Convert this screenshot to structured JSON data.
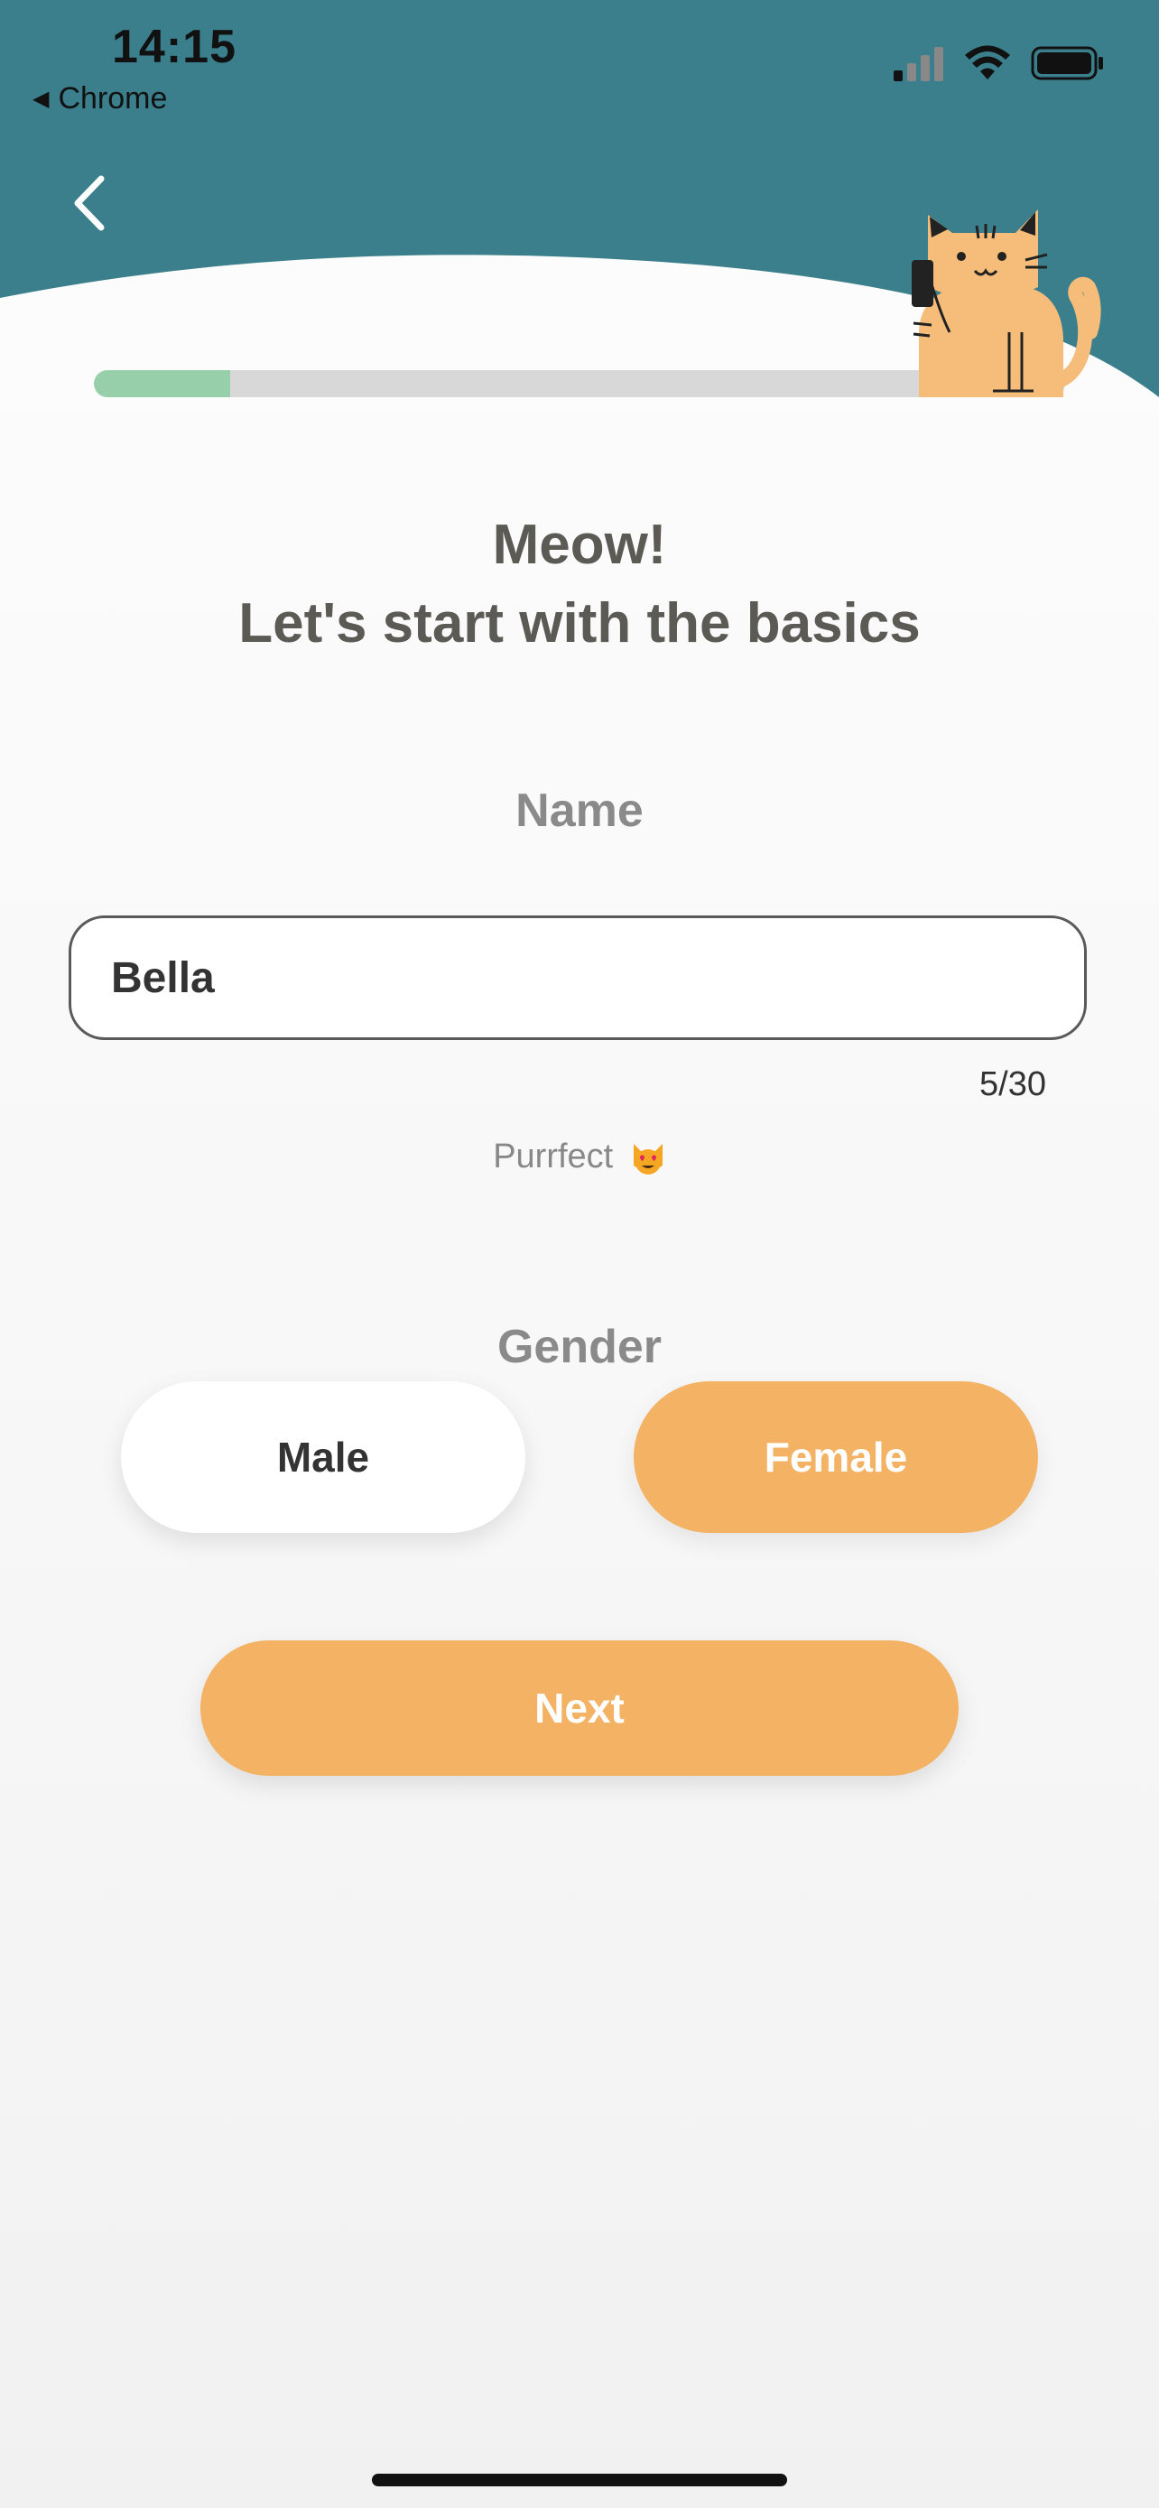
{
  "status_bar": {
    "time": "14:15",
    "back_app": "Chrome",
    "icons": [
      "signal-icon",
      "wifi-icon",
      "battery-icon"
    ]
  },
  "header": {
    "back_icon": "chevron-left-icon",
    "mascot": "cat-with-phone-illustration",
    "bg_color": "#3a7f8b"
  },
  "progress": {
    "value": 0.14,
    "fill_color": "#97cfab"
  },
  "title": {
    "line1": "Meow!",
    "line2": "Let's start with the basics"
  },
  "name_section": {
    "label": "Name",
    "value": "Bella",
    "counter": "5/30",
    "hint": "Purrfect"
  },
  "gender_section": {
    "label": "Gender",
    "options": [
      "Male",
      "Female"
    ],
    "selected": "Female"
  },
  "next_label": "Next",
  "colors": {
    "accent": "#f3b264",
    "teal": "#3a7f8b"
  }
}
